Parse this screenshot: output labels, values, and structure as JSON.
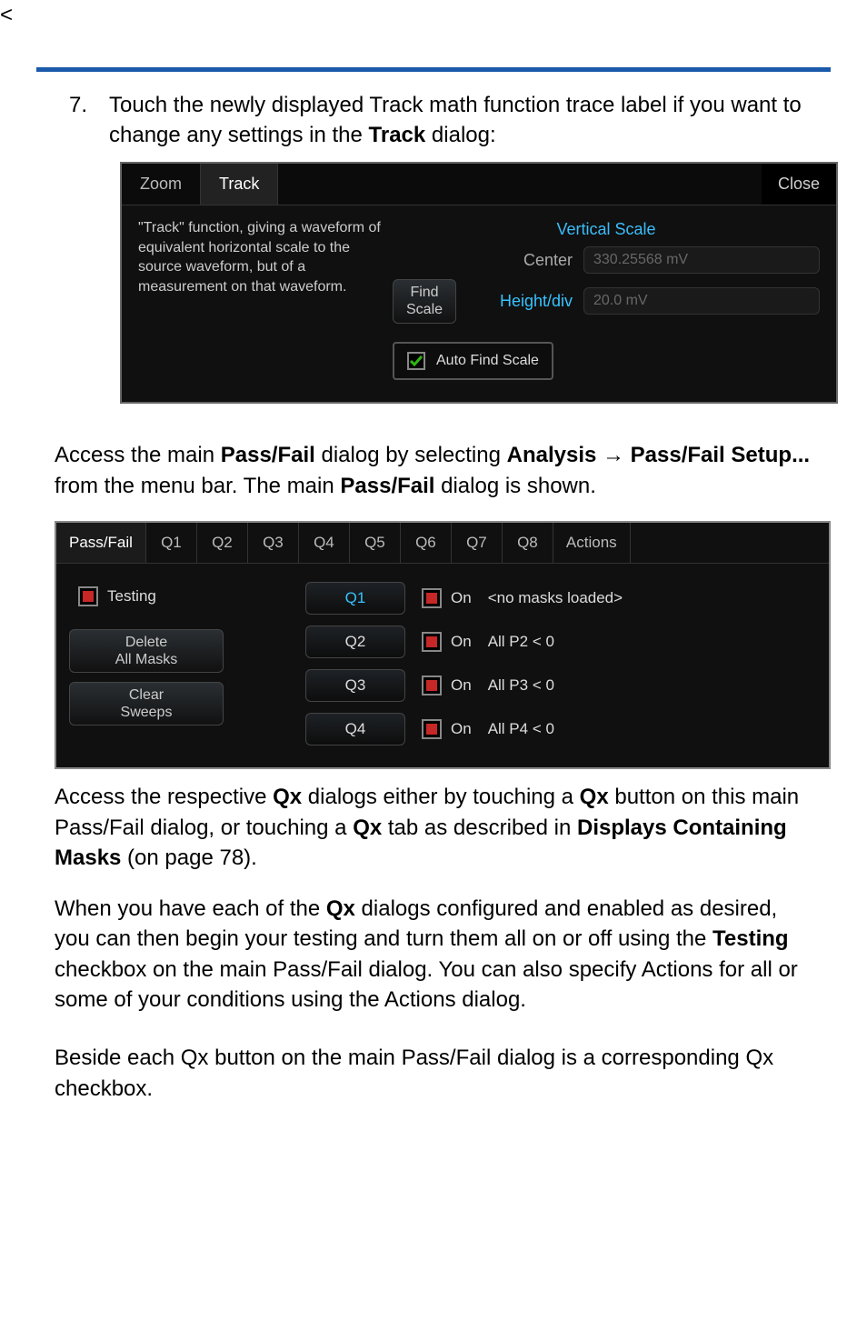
{
  "step": {
    "num": "7.",
    "text_a": "Touch the newly displayed Track math function trace label if you want to change any settings in the ",
    "text_b": "Track",
    "text_c": " dialog:"
  },
  "dialog1": {
    "tabs": {
      "zoom": "Zoom",
      "track": "Track"
    },
    "close": "Close",
    "desc": "\"Track\" function, giving a waveform of equivalent horizontal scale to the source waveform, but of a measurement on that waveform.",
    "vscale_title": "Vertical Scale",
    "center_label": "Center",
    "center_value": "330.25568 mV",
    "height_label": "Height/div",
    "height_value": "20.0 mV",
    "find_btn": "Find\nScale",
    "auto_find": "Auto Find Scale"
  },
  "para1": {
    "a": "Access the main ",
    "b": "Pass/Fail",
    "c": " dialog by selecting ",
    "d": "Analysis → Pass/Fail Setup...",
    "e": " from the menu bar. The main ",
    "f": "Pass/Fail",
    "g": " dialog is shown."
  },
  "dialog2": {
    "tabs": [
      "Pass/Fail",
      "Q1",
      "Q2",
      "Q3",
      "Q4",
      "Q5",
      "Q6",
      "Q7",
      "Q8",
      "Actions"
    ],
    "testing_label": "Testing",
    "delete_btn": "Delete\nAll Masks",
    "clear_btn": "Clear\nSweeps",
    "rows": [
      {
        "q": "Q1",
        "on": "On",
        "rule": "<no masks loaded>"
      },
      {
        "q": "Q2",
        "on": "On",
        "rule": "All P2 < 0"
      },
      {
        "q": "Q3",
        "on": "On",
        "rule": "All P3 < 0"
      },
      {
        "q": "Q4",
        "on": "On",
        "rule": "All P4 < 0"
      }
    ]
  },
  "para2": {
    "a": "Access the respective ",
    "b": "Qx",
    "c": " dialogs either by touching a ",
    "d": "Qx",
    "e": " button on this main Pass/Fail dialog, or touching a ",
    "f": "Qx",
    "g": " tab as described in ",
    "h": "Displays Containing Masks",
    "i": " (on page 78)."
  },
  "para3": {
    "a": "When you have each of the ",
    "b": "Qx",
    "c": " dialogs configured and enabled as desired, you can then begin your testing and turn them all on or off using the ",
    "d": "Testing",
    "e": " checkbox on the main Pass/Fail dialog. You can also specify Actions for all or some of your conditions using the Actions dialog."
  },
  "para4": "Beside each Qx button on the main Pass/Fail dialog is a corresponding Qx checkbox."
}
